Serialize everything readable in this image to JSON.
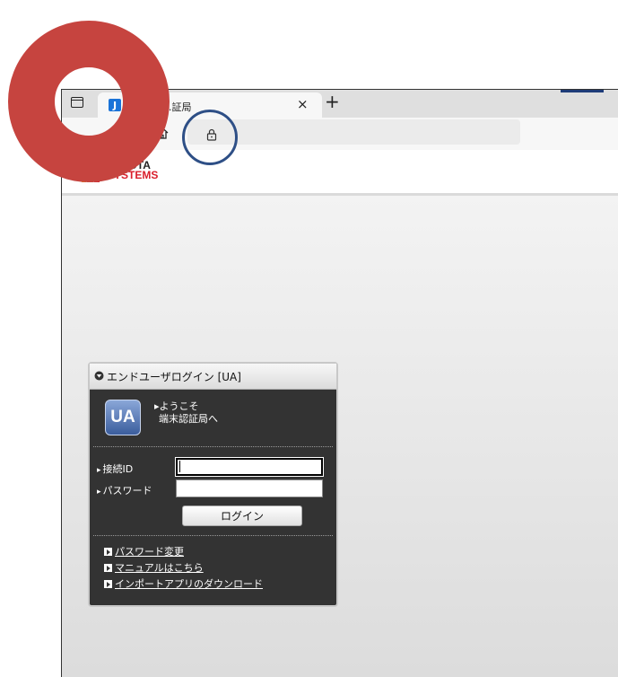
{
  "browser": {
    "tab": {
      "favicon_letter": "J",
      "title": "...証局",
      "close": "×"
    },
    "new_tab": "+"
  },
  "header": {
    "logo_line1": "TOYOTA",
    "logo_line2": "SYSTEMS"
  },
  "login": {
    "panel_title": "エンドユーザログイン [UA]",
    "badge": "UA",
    "welcome_line1": "▸ようこそ",
    "welcome_line2": "端末認証局へ",
    "id_label": "接続ID",
    "id_value": "",
    "password_label": "パスワード",
    "password_value": "",
    "login_button": "ログイン",
    "links": [
      "パスワード変更",
      "マニュアルはこちら",
      "インポートアプリのダウンロード"
    ]
  },
  "annotations": {
    "ring_color": "#c6443f",
    "circle_color": "#2e4f86"
  },
  "icons": [
    "sidebar-toggle-icon",
    "home-icon",
    "lock-icon",
    "tab-close-icon",
    "new-tab-icon"
  ]
}
